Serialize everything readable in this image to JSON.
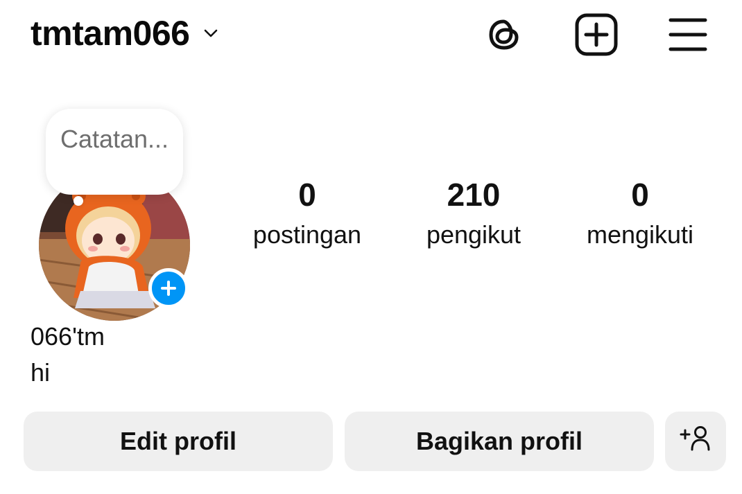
{
  "header": {
    "username": "tmtam066",
    "icons": [
      "chevron-down-icon",
      "threads-icon",
      "new-post-icon",
      "menu-icon"
    ]
  },
  "profile": {
    "note_placeholder": "Catatan...",
    "stats": [
      {
        "value": "0",
        "label": "postingan"
      },
      {
        "value": "210",
        "label": "pengikut"
      },
      {
        "value": "0",
        "label": "mengikuti"
      }
    ],
    "display_name": "066'tm",
    "bio": "hi"
  },
  "actions": {
    "edit_label": "Edit profil",
    "share_label": "Bagikan profil"
  },
  "colors": {
    "accent": "#0095f6",
    "button_bg": "#efefef",
    "text": "#111111",
    "muted": "#6e6e6e"
  }
}
